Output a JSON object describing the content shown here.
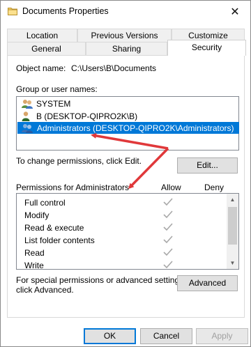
{
  "window": {
    "title": "Documents Properties",
    "close_glyph": "✕"
  },
  "tabs": {
    "row_back": [
      "Location",
      "Previous Versions",
      "Customize"
    ],
    "row_front": [
      "General",
      "Sharing",
      "Security"
    ],
    "active": "Security"
  },
  "security": {
    "object_name_label": "Object name:",
    "object_name_value": "C:\\Users\\B\\Documents",
    "group_label": "Group or user names:",
    "principals": [
      {
        "name": "SYSTEM",
        "icon": "users-group-icon",
        "selected": false
      },
      {
        "name": "B (DESKTOP-QIPRO2K\\B)",
        "icon": "user-icon",
        "selected": false
      },
      {
        "name": "Administrators (DESKTOP-QIPRO2K\\Administrators)",
        "icon": "users-group-icon",
        "selected": true
      }
    ],
    "change_hint": "To change permissions, click Edit.",
    "edit_button": "Edit...",
    "permissions_label": "Permissions for Administrators",
    "allow_header": "Allow",
    "deny_header": "Deny",
    "permissions": [
      {
        "name": "Full control",
        "allow": true,
        "deny": false
      },
      {
        "name": "Modify",
        "allow": true,
        "deny": false
      },
      {
        "name": "Read & execute",
        "allow": true,
        "deny": false
      },
      {
        "name": "List folder contents",
        "allow": true,
        "deny": false
      },
      {
        "name": "Read",
        "allow": true,
        "deny": false
      },
      {
        "name": "Write",
        "allow": true,
        "deny": false
      }
    ],
    "advanced_hint_line1": "For special permissions or advanced settings,",
    "advanced_hint_line2": "click Advanced.",
    "advanced_button": "Advanced"
  },
  "footer": {
    "ok": "OK",
    "cancel": "Cancel",
    "apply": "Apply"
  },
  "colors": {
    "selection": "#0078d7",
    "annotation_arrow": "#e0383a",
    "check_disabled": "#a8a8a8"
  }
}
